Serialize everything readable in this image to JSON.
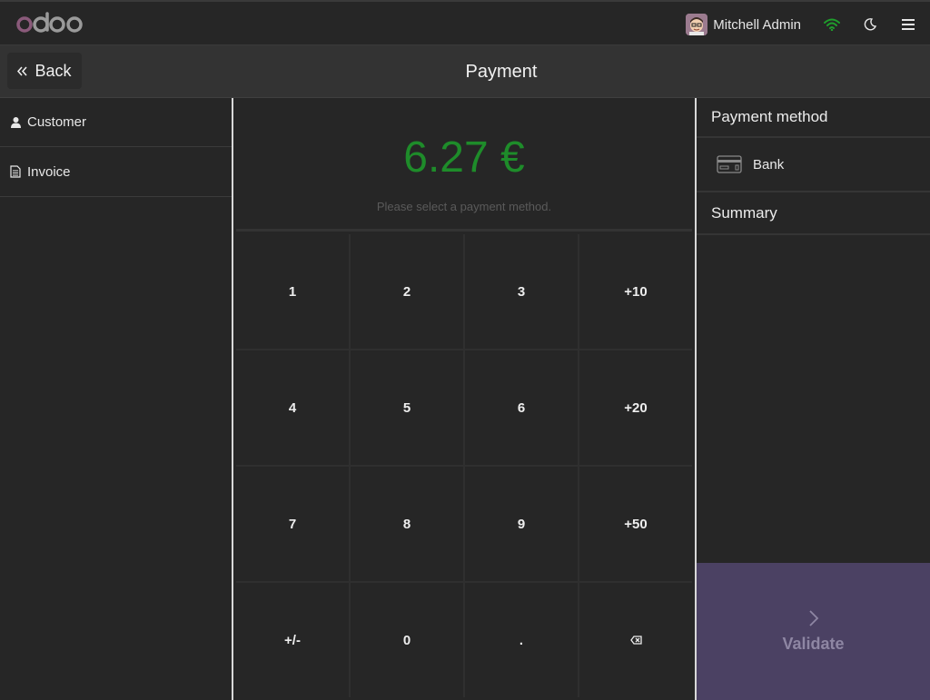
{
  "app": {
    "logo_text": "odoo",
    "user_name": "Mitchell Admin",
    "icons": [
      "avatar",
      "wifi-icon",
      "moon-icon",
      "menu-icon"
    ],
    "colors": {
      "wifi": "#1f9e2c",
      "logo_o": "#8a5a7a",
      "logo_doo": "#9a9a9a"
    }
  },
  "header": {
    "back_label": "Back",
    "title": "Payment"
  },
  "left": {
    "items": [
      {
        "label": "Customer",
        "icon": "user-icon"
      },
      {
        "label": "Invoice",
        "icon": "invoice-icon"
      }
    ]
  },
  "center": {
    "amount": "6.27 €",
    "amount_color": "#1e8c2a",
    "hint": "Please select a payment method.",
    "keys": [
      "1",
      "2",
      "3",
      "+10",
      "4",
      "5",
      "6",
      "+20",
      "7",
      "8",
      "9",
      "+50",
      "+/-",
      "0",
      ".",
      "⌫"
    ]
  },
  "right": {
    "payment_method_title": "Payment method",
    "methods": [
      {
        "label": "Bank",
        "icon": "card-icon"
      }
    ],
    "summary_title": "Summary",
    "validate_label": "Validate",
    "validate_color": "#4b4163"
  }
}
